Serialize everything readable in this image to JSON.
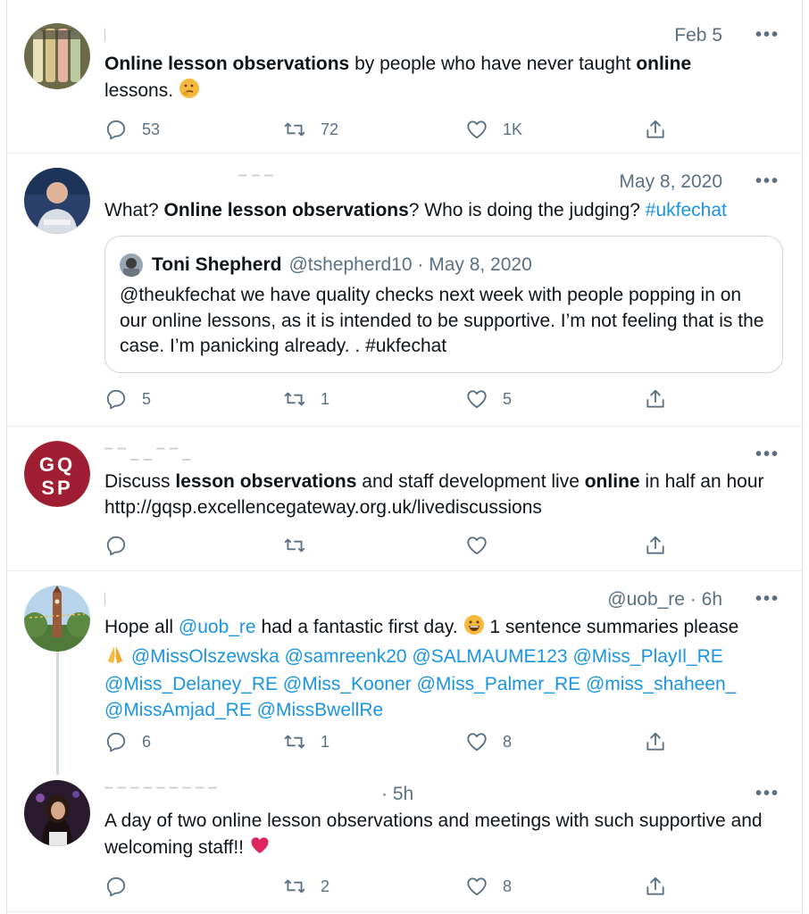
{
  "tweets": [
    {
      "date": "Feb 5",
      "text": [
        {
          "t": "Online lesson observations",
          "b": true
        },
        {
          "t": " by people who have never taught "
        },
        {
          "t": "online",
          "b": true
        },
        {
          "t": " lessons. "
        }
      ],
      "emoji": "thinking-face",
      "replies": "53",
      "retweets": "72",
      "likes": "1K"
    },
    {
      "date": "May 8, 2020",
      "text": [
        {
          "t": "What? "
        },
        {
          "t": "Online lesson observations",
          "b": true
        },
        {
          "t": "? Who is doing the judging? "
        },
        {
          "t": "#ukfechat",
          "link": true
        }
      ],
      "quote": {
        "name": "Toni Shepherd",
        "handle": "@tshepherd10 · May 8, 2020",
        "text": "@theukfechat we have quality checks next week with people popping in on our online lessons, as it is intended to be supportive. I’m not feeling that is the case. I’m panicking already. .  #ukfechat"
      },
      "replies": "5",
      "retweets": "1",
      "likes": "5"
    },
    {
      "avatar_text": [
        "GQ",
        "SP"
      ],
      "text": [
        {
          "t": "Discuss "
        },
        {
          "t": "lesson observations",
          "b": true
        },
        {
          "t": " and staff development live "
        },
        {
          "t": "online",
          "b": true
        },
        {
          "t": " in half an hour http://gqsp.excellencegateway.org.uk/livediscussions"
        }
      ],
      "replies": "",
      "retweets": "",
      "likes": ""
    },
    {
      "date": "@uob_re · 6h",
      "text": [
        {
          "t": "Hope all "
        },
        {
          "t": "@uob_re",
          "link": true
        },
        {
          "t": " had a fantastic first day.  "
        },
        {
          "emoji": "grinning-face"
        },
        {
          "t": " 1 sentence summaries please "
        },
        {
          "emoji": "folded-hands"
        },
        {
          "t": " "
        },
        {
          "t": "@MissOlszewska @samreenk20 @SALMAUME123 @Miss_PlayIl_RE @Miss_Delaney_RE @Miss_Kooner @Miss_Palmer_RE @miss_shaheen_ @MissAmjad_RE @MissBwellRe",
          "link": true
        }
      ],
      "replies": "6",
      "retweets": "1",
      "likes": "8"
    },
    {
      "date": "· 5h",
      "text": [
        {
          "t": "A day of two online lesson observations and meetings with such supportive and welcoming staff!! "
        }
      ],
      "emoji": "heart",
      "replies": "",
      "retweets": "2",
      "likes": "8"
    }
  ],
  "colors": {
    "accent": "#1b95e0",
    "muted": "#5b7083",
    "gqsp": "#a01e32",
    "border": "#e6ecf0"
  }
}
